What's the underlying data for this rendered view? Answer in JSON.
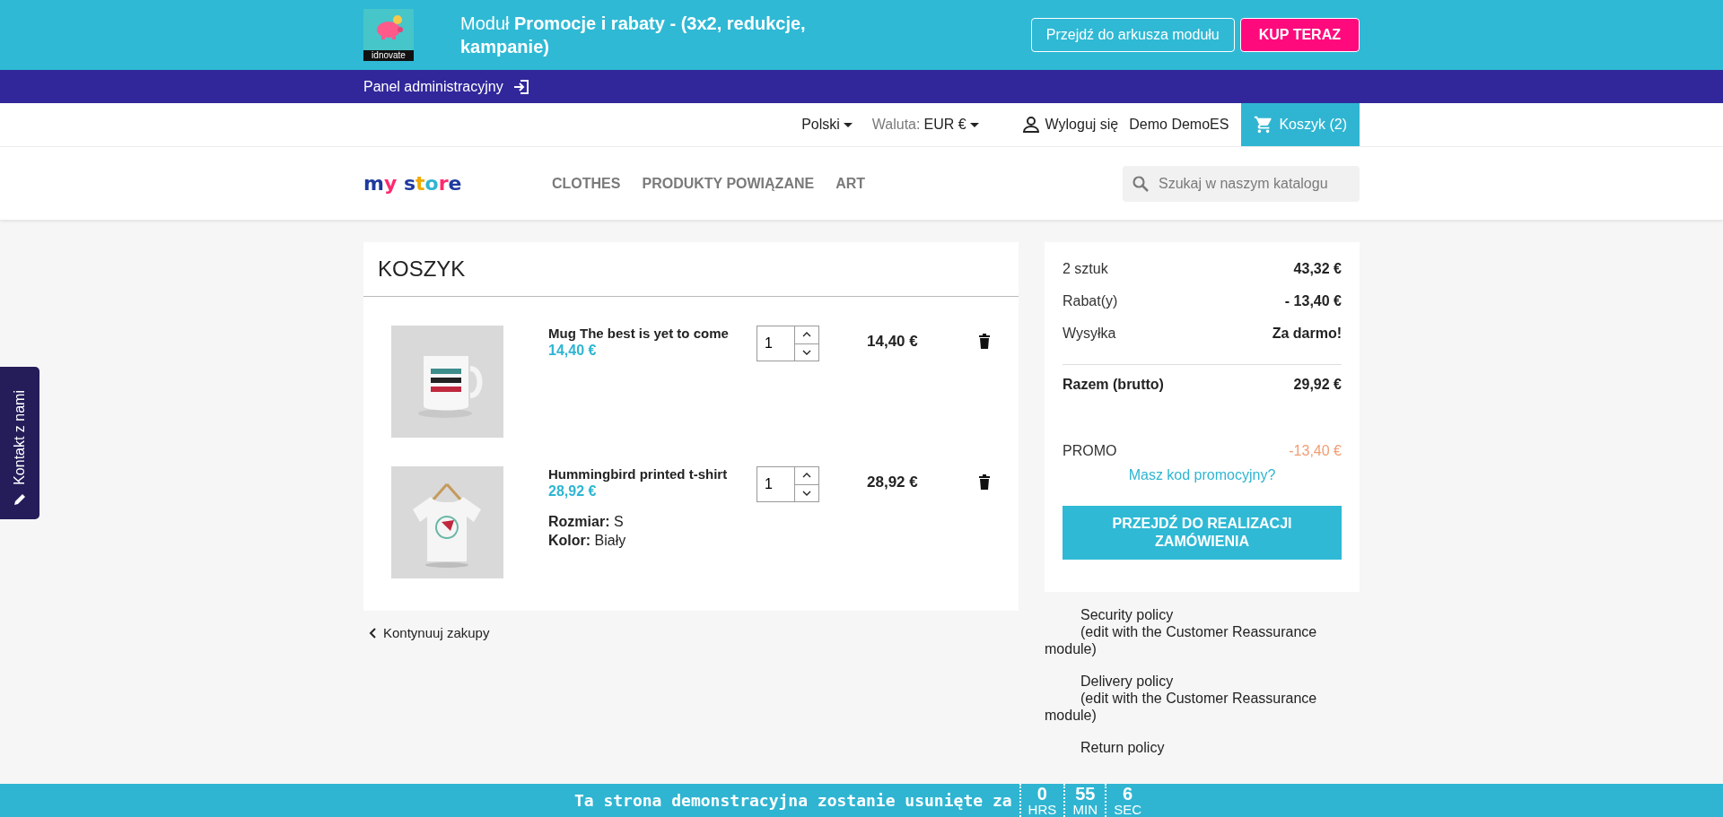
{
  "banner": {
    "logo_text": "idnovate",
    "title": "Moduł **Promocje i rabaty - (3x2, redukcje, kampanie)**",
    "sheet_button": "Przejdź do arkusza modułu",
    "buy_button": "KUP TERAZ"
  },
  "admin_bar": {
    "label": "Panel administracyjny"
  },
  "nav": {
    "language": "Polski",
    "currency_label": "Waluta:",
    "currency": "EUR €",
    "logout": "Wyloguj się",
    "user": "Demo DemoES",
    "cart": "Koszyk (2)"
  },
  "header": {
    "logo": "my store",
    "menu": [
      {
        "label": "CLOTHES"
      },
      {
        "label": "PRODUKTY POWIĄZANE"
      },
      {
        "label": "ART"
      }
    ],
    "search": {
      "placeholder": "Szukaj w naszym katalogu"
    }
  },
  "cart": {
    "title": "KOSZYK",
    "items": [
      {
        "name": "Mug The best is yet to come",
        "unit_price": "14,40 €",
        "quantity": "1",
        "total": "14,40 €"
      },
      {
        "name": "Hummingbird printed t-shirt",
        "unit_price": "28,92 €",
        "quantity": "1",
        "total": "28,92 €",
        "attributes": [
          {
            "label": "Rozmiar:",
            "value": "S"
          },
          {
            "label": "Kolor:",
            "value": "Biały"
          }
        ]
      }
    ],
    "continue_link": "Kontynuuj zakupy"
  },
  "summary": {
    "lines": [
      {
        "label": "2 sztuk",
        "value": "43,32 €"
      },
      {
        "label": "Rabat(y)",
        "value": "- 13,40 €"
      },
      {
        "label": "Wysyłka",
        "value": "Za darmo!"
      }
    ],
    "total": {
      "label": "Razem (brutto)",
      "value": "29,92 €"
    },
    "promo": {
      "label": "PROMO",
      "value": "-13,40 €"
    },
    "promo_link": "Masz kod promocyjny?",
    "checkout_button": "PRZEJDŹ DO REALIZACJI ZAMÓWIENIA"
  },
  "reassurance": [
    {
      "title": "Security policy",
      "note": "(edit with the Customer Reassurance module)"
    },
    {
      "title": "Delivery policy",
      "note": "(edit with the Customer Reassurance module)"
    },
    {
      "title": "Return policy"
    }
  ],
  "contact_tab": {
    "label": "Kontakt z nami"
  },
  "countdown": {
    "message": "Ta strona demonstracyjna zostanie usunięte za",
    "units": [
      {
        "value": "0",
        "label": "HRS"
      },
      {
        "value": "55",
        "label": "MIN"
      },
      {
        "value": "6",
        "label": "SEC"
      }
    ]
  }
}
